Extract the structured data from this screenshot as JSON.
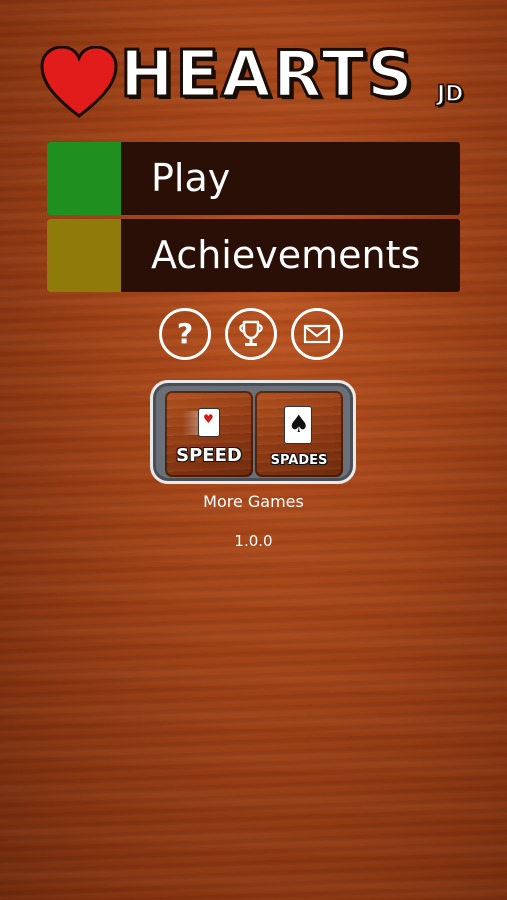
{
  "logo": {
    "word": "HEARTS",
    "suffix": "JD",
    "heart_color": "#e21b1b"
  },
  "menu": [
    {
      "label": "Play",
      "swatch_color": "#1f8f1f"
    },
    {
      "label": "Achievements",
      "swatch_color": "#8f7a0a"
    }
  ],
  "icons": {
    "help": "question-icon",
    "achievements": "trophy-icon",
    "contact": "mail-icon"
  },
  "more_games": {
    "tiles": [
      {
        "label": "SPEED",
        "card_suit": "♥"
      },
      {
        "label": "SPADES",
        "card_suit": "♠"
      }
    ],
    "link_label": "More Games"
  },
  "version": "1.0.0"
}
